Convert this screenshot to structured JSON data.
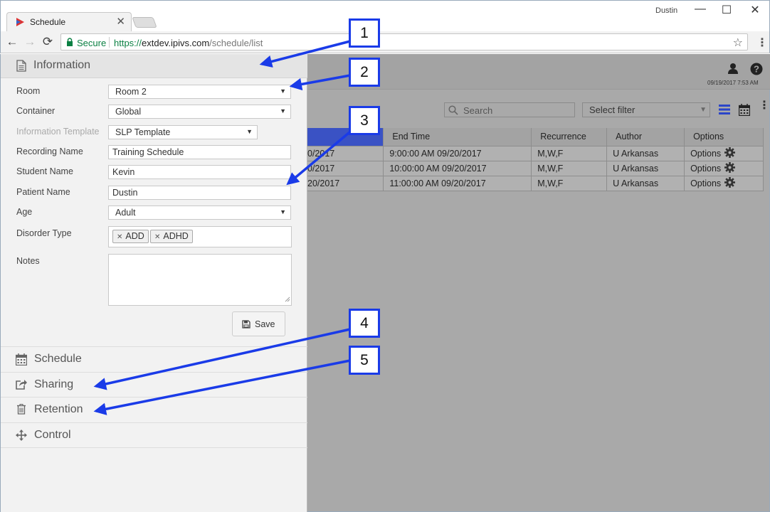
{
  "browser": {
    "tab_title": "Schedule",
    "tab_close": "✕",
    "window_user": "Dustin",
    "minimize": "—",
    "maximize": "☐",
    "close": "✕",
    "back": "←",
    "forward": "→",
    "reload": "⟳",
    "secure_label": "Secure",
    "url_scheme": "https://",
    "url_host": "extdev.ipivs.com",
    "url_path": "/schedule/list",
    "bookmark": "☆",
    "menu": "⋮"
  },
  "page": {
    "datetime": "09/19/2017 7:53 AM",
    "search_placeholder": "Search",
    "filter_placeholder": "Select filter",
    "columns": [
      "",
      "End Time",
      "Recurrence",
      "Author",
      "Options"
    ],
    "rows": [
      {
        "start": "0/2017",
        "end": "9:00:00 AM 09/20/2017",
        "recurrence": "M,W,F",
        "author": "U Arkansas",
        "options": "Options"
      },
      {
        "start": "0/2017",
        "end": "10:00:00 AM 09/20/2017",
        "recurrence": "M,W,F",
        "author": "U Arkansas",
        "options": "Options"
      },
      {
        "start": "20/2017",
        "end": "11:00:00 AM 09/20/2017",
        "recurrence": "M,W,F",
        "author": "U Arkansas",
        "options": "Options"
      }
    ]
  },
  "panel": {
    "title": "Information",
    "fields": {
      "room": {
        "label": "Room",
        "value": "Room 2"
      },
      "container": {
        "label": "Container",
        "value": "Global"
      },
      "template": {
        "label": "Information Template",
        "value": "SLP Template"
      },
      "recording": {
        "label": "Recording Name",
        "value": "Training Schedule"
      },
      "student": {
        "label": "Student Name",
        "value": "Kevin"
      },
      "patient": {
        "label": "Patient Name",
        "value": "Dustin"
      },
      "age": {
        "label": "Age",
        "value": "Adult"
      }
    },
    "disorder_label": "Disorder Type",
    "disorder_tags": [
      "ADD",
      "ADHD"
    ],
    "notes_label": "Notes",
    "save_label": "Save",
    "sections": [
      "Schedule",
      "Sharing",
      "Retention",
      "Control"
    ]
  },
  "annotations": [
    "1",
    "2",
    "3",
    "4",
    "5"
  ],
  "colors": {
    "accent": "#3a52c4",
    "annotation": "#1a3be8"
  }
}
